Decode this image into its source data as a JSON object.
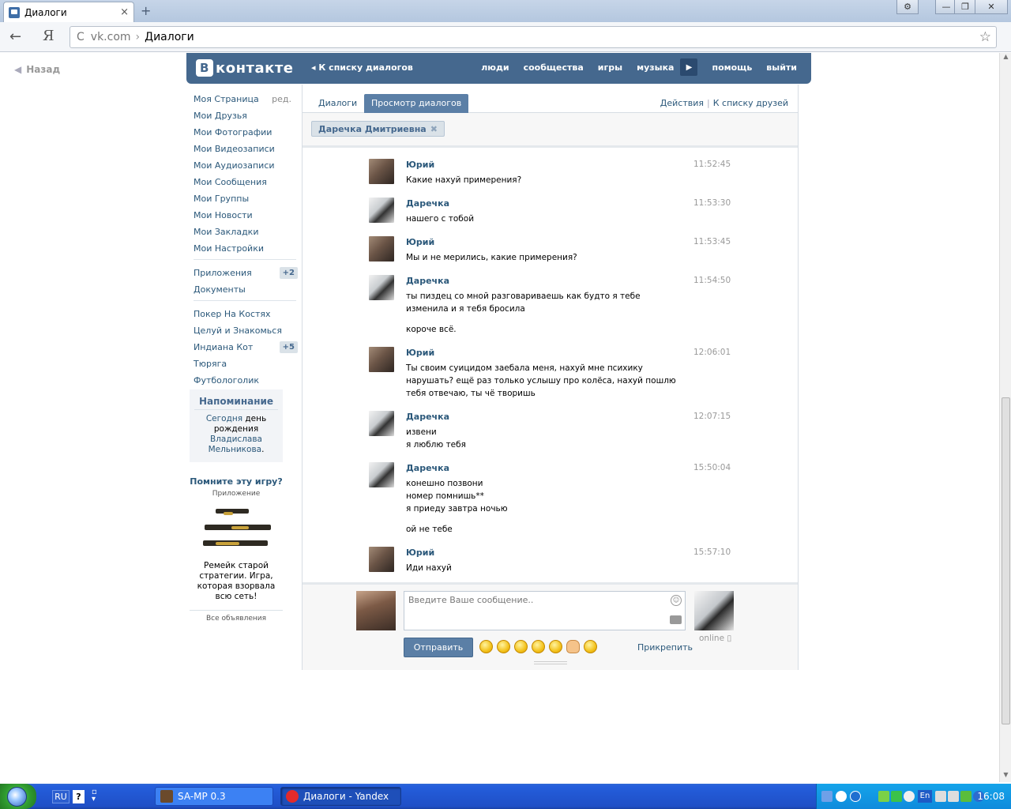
{
  "browser": {
    "tab_title": "Диалоги",
    "url_host": "vk.com",
    "url_sep": "›",
    "url_page": "Диалоги",
    "back_glyph": "←",
    "ya_glyph": "Я",
    "reload_glyph": "C",
    "star_glyph": "☆",
    "close_glyph": "×",
    "newtab_glyph": "+",
    "settings_glyph": "⚙",
    "min_glyph": "—",
    "max_glyph": "❐",
    "winclose_glyph": "✕"
  },
  "page": {
    "back_link": "Назад"
  },
  "vk_header": {
    "logo_b": "B",
    "logo_text": "контакте",
    "back_to_dialogs": "К списку диалогов",
    "nav": [
      "люди",
      "сообщества",
      "игры",
      "музыка",
      "помощь",
      "выйти"
    ]
  },
  "left_menu": {
    "edit": "ред.",
    "items": [
      "Моя Страница",
      "Мои Друзья",
      "Мои Фотографии",
      "Мои Видеозаписи",
      "Мои Аудиозаписи",
      "Мои Сообщения",
      "Мои Группы",
      "Мои Новости",
      "Мои Закладки",
      "Мои Настройки"
    ],
    "apps": [
      {
        "label": "Приложения",
        "badge": "+2"
      },
      {
        "label": "Документы",
        "badge": ""
      }
    ],
    "games": [
      {
        "label": "Покер На Костях",
        "badge": ""
      },
      {
        "label": "Целуй и Знакомься",
        "badge": ""
      },
      {
        "label": "Индиана Кот",
        "badge": "+5"
      },
      {
        "label": "Тюряга",
        "badge": ""
      },
      {
        "label": "Футбологолик",
        "badge": ""
      }
    ]
  },
  "reminder": {
    "title": "Напоминание",
    "today": "Сегодня",
    "text1": " день рождения ",
    "name": "Владислава Мельникова",
    "end": "."
  },
  "ad": {
    "title": "Помните эту игру?",
    "subtitle": "Приложение",
    "text": "Ремейк старой стратегии. Игра, которая взорвала всю сеть!",
    "all_ads": "Все объявления"
  },
  "dialog": {
    "tab_dialogs": "Диалоги",
    "tab_view": "Просмотр диалогов",
    "actions": "Действия",
    "divider": "|",
    "friends_list": "К списку друзей",
    "peer_name": "Даречка Дмитриевна",
    "peer_close": "✖"
  },
  "messages": [
    {
      "author": "Юрий",
      "who": "yuri",
      "time": "11:52:45",
      "lines": [
        "Какие нахуй примерения?"
      ]
    },
    {
      "author": "Даречка",
      "who": "daria",
      "time": "11:53:30",
      "lines": [
        "нашего с тобой"
      ]
    },
    {
      "author": "Юрий",
      "who": "yuri",
      "time": "11:53:45",
      "lines": [
        "Мы и не мерились, какие примерения?"
      ]
    },
    {
      "author": "Даречка",
      "who": "daria",
      "time": "11:54:50",
      "lines": [
        "ты пиздец со мной разговариваешь как будто я тебе изменила и я тебя бросила",
        "",
        "короче всё."
      ]
    },
    {
      "author": "Юрий",
      "who": "yuri",
      "time": "12:06:01",
      "lines": [
        "Ты своим суицидом заебала меня, нахуй мне психику нарушать? ещё раз только услышу про колёса, нахуй пошлю тебя отвечаю, ты чё творишь"
      ]
    },
    {
      "author": "Даречка",
      "who": "daria",
      "time": "12:07:15",
      "lines": [
        "извени",
        "я люблю тебя"
      ]
    },
    {
      "author": "Даречка",
      "who": "daria",
      "time": "15:50:04",
      "lines": [
        "конешно позвони",
        "номер помнишь**",
        "я приеду завтра ночью",
        "",
        "ой не тебе"
      ]
    },
    {
      "author": "Юрий",
      "who": "yuri",
      "time": "15:57:10",
      "lines": [
        "Иди нахуй"
      ]
    }
  ],
  "composer": {
    "placeholder": "Введите Ваше сообщение..",
    "send": "Отправить",
    "attach": "Прикрепить",
    "online": "online",
    "smile_glyph": "☺"
  },
  "taskbar": {
    "lang": "RU",
    "help": "?",
    "task1": "SA-MP 0.3",
    "task2": "Диалоги - Yandex",
    "tray_lang": "En",
    "clock": "16:08"
  }
}
